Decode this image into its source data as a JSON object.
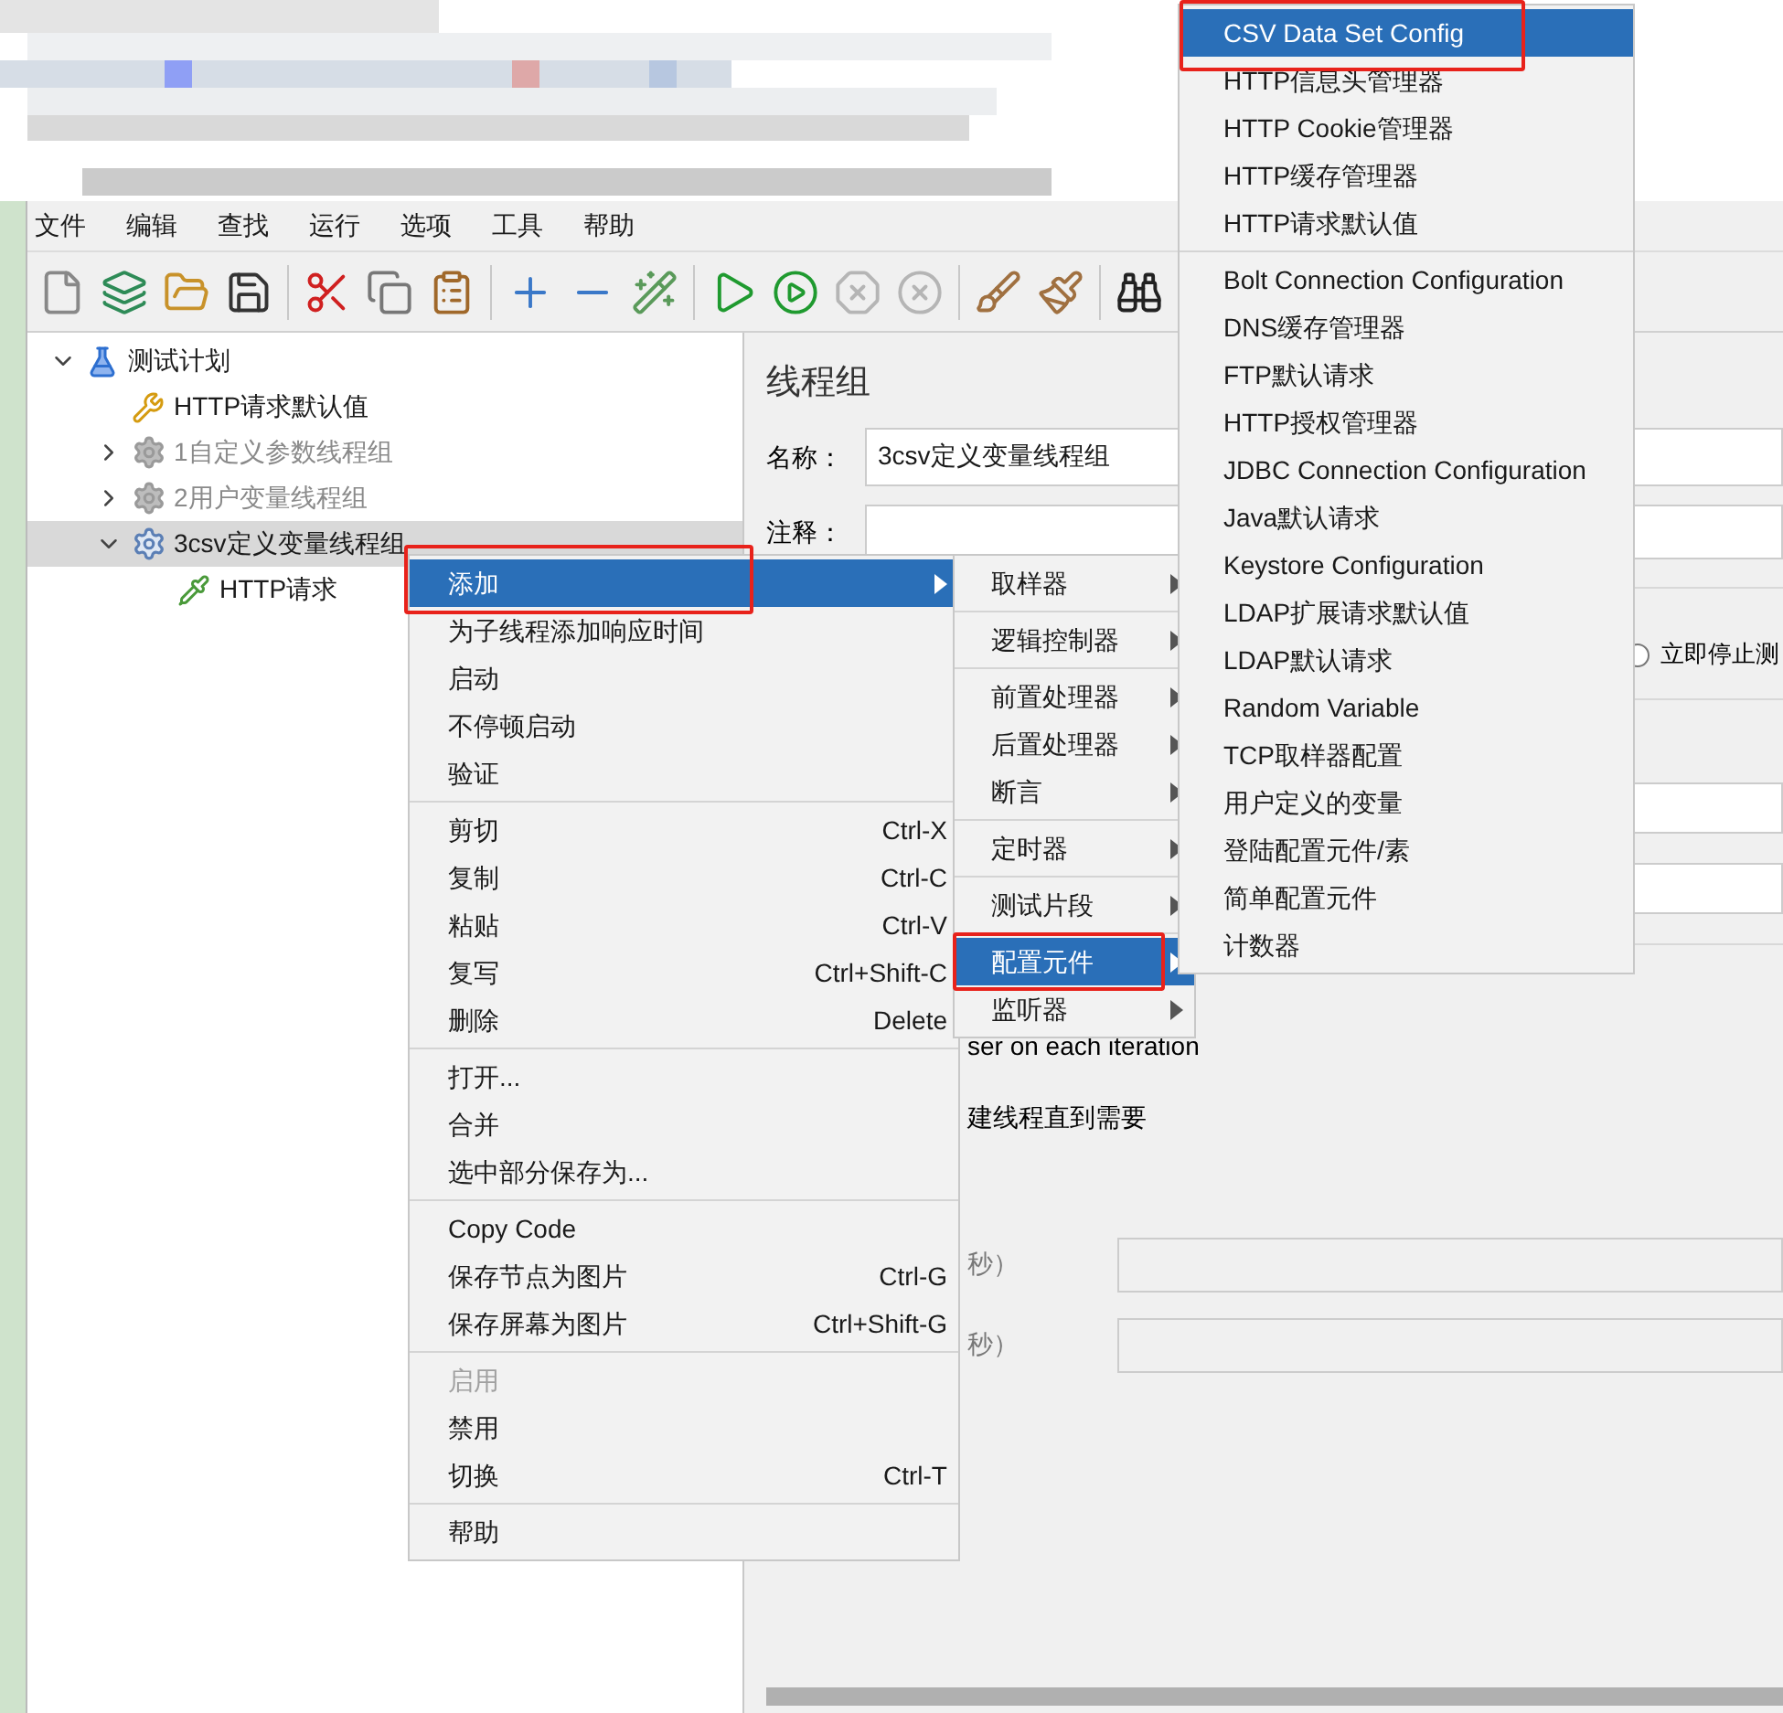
{
  "menu_bar": [
    {
      "label": "文件"
    },
    {
      "label": "编辑"
    },
    {
      "label": "查找"
    },
    {
      "label": "运行"
    },
    {
      "label": "选项"
    },
    {
      "label": "工具"
    },
    {
      "label": "帮助"
    }
  ],
  "tree": [
    {
      "label": "测试计划",
      "kind": "plan",
      "expanded": true,
      "selected": false,
      "disabled": false,
      "children": [
        {
          "label": "HTTP请求默认值",
          "kind": "config",
          "selected": false,
          "disabled": false
        },
        {
          "label": "1自定义参数线程组",
          "kind": "thread_group",
          "expanded": false,
          "selected": false,
          "disabled": true
        },
        {
          "label": "2用户变量线程组",
          "kind": "thread_group",
          "expanded": false,
          "selected": false,
          "disabled": true
        },
        {
          "label": "3csv定义变量线程组",
          "kind": "thread_group",
          "expanded": true,
          "selected": true,
          "disabled": false,
          "children": [
            {
              "label": "HTTP请求",
              "kind": "sampler",
              "selected": false,
              "disabled": false
            }
          ]
        }
      ]
    }
  ],
  "panel": {
    "title": "线程组",
    "name_label": "名称：",
    "name_value": "3csv定义变量线程组",
    "comment_label": "注释：",
    "option_text": "立即停止测",
    "option_selected": false,
    "iteration_text": "ser on each iteration",
    "delay_text": "建线程直到需要",
    "duration_labels": [
      "秒）",
      "秒）"
    ]
  },
  "context_menu": [
    [
      {
        "label": "添加",
        "submenu": true,
        "selected": true,
        "disabled": false
      },
      {
        "label": "为子线程添加响应时间",
        "submenu": false,
        "selected": false,
        "disabled": false
      },
      {
        "label": "启动",
        "submenu": false,
        "selected": false,
        "disabled": false
      },
      {
        "label": "不停顿启动",
        "submenu": false,
        "selected": false,
        "disabled": false
      },
      {
        "label": "验证",
        "submenu": false,
        "selected": false,
        "disabled": false
      }
    ],
    [
      {
        "label": "剪切",
        "shortcut": "Ctrl-X",
        "submenu": false,
        "selected": false,
        "disabled": false
      },
      {
        "label": "复制",
        "shortcut": "Ctrl-C",
        "submenu": false,
        "selected": false,
        "disabled": false
      },
      {
        "label": "粘贴",
        "shortcut": "Ctrl-V",
        "submenu": false,
        "selected": false,
        "disabled": false
      },
      {
        "label": "复写",
        "shortcut": "Ctrl+Shift-C",
        "submenu": false,
        "selected": false,
        "disabled": false
      },
      {
        "label": "删除",
        "shortcut": "Delete",
        "submenu": false,
        "selected": false,
        "disabled": false
      }
    ],
    [
      {
        "label": "打开...",
        "submenu": false,
        "selected": false,
        "disabled": false
      },
      {
        "label": "合并",
        "submenu": false,
        "selected": false,
        "disabled": false
      },
      {
        "label": "选中部分保存为...",
        "submenu": false,
        "selected": false,
        "disabled": false
      }
    ],
    [
      {
        "label": "Copy Code",
        "submenu": false,
        "selected": false,
        "disabled": false
      },
      {
        "label": "保存节点为图片",
        "shortcut": "Ctrl-G",
        "submenu": false,
        "selected": false,
        "disabled": false
      },
      {
        "label": "保存屏幕为图片",
        "shortcut": "Ctrl+Shift-G",
        "submenu": false,
        "selected": false,
        "disabled": false
      }
    ],
    [
      {
        "label": "启用",
        "submenu": false,
        "selected": false,
        "disabled": true
      },
      {
        "label": "禁用",
        "submenu": false,
        "selected": false,
        "disabled": false
      },
      {
        "label": "切换",
        "shortcut": "Ctrl-T",
        "submenu": false,
        "selected": false,
        "disabled": false
      }
    ],
    [
      {
        "label": "帮助",
        "submenu": false,
        "selected": false,
        "disabled": false
      }
    ]
  ],
  "add_submenu": [
    [
      {
        "label": "取样器",
        "selected": false
      }
    ],
    [
      {
        "label": "逻辑控制器",
        "selected": false
      }
    ],
    [
      {
        "label": "前置处理器",
        "selected": false
      },
      {
        "label": "后置处理器",
        "selected": false
      },
      {
        "label": "断言",
        "selected": false
      }
    ],
    [
      {
        "label": "定时器",
        "selected": false
      }
    ],
    [
      {
        "label": "测试片段",
        "selected": false
      }
    ],
    [
      {
        "label": "配置元件",
        "selected": true
      },
      {
        "label": "监听器",
        "selected": false
      }
    ]
  ],
  "config_submenu": [
    [
      {
        "label": "CSV Data Set Config",
        "selected": true
      },
      {
        "label": "HTTP信息头管理器",
        "selected": false
      },
      {
        "label": "HTTP Cookie管理器",
        "selected": false
      },
      {
        "label": "HTTP缓存管理器",
        "selected": false
      },
      {
        "label": "HTTP请求默认值",
        "selected": false
      }
    ],
    [
      {
        "label": "Bolt Connection Configuration",
        "selected": false
      },
      {
        "label": "DNS缓存管理器",
        "selected": false
      },
      {
        "label": "FTP默认请求",
        "selected": false
      },
      {
        "label": "HTTP授权管理器",
        "selected": false
      },
      {
        "label": "JDBC Connection Configuration",
        "selected": false
      },
      {
        "label": "Java默认请求",
        "selected": false
      },
      {
        "label": "Keystore Configuration",
        "selected": false
      },
      {
        "label": "LDAP扩展请求默认值",
        "selected": false
      },
      {
        "label": "LDAP默认请求",
        "selected": false
      },
      {
        "label": "Random Variable",
        "selected": false
      },
      {
        "label": "TCP取样器配置",
        "selected": false
      },
      {
        "label": "用户定义的变量",
        "selected": false
      },
      {
        "label": "登陆配置元件/素",
        "selected": false
      },
      {
        "label": "简单配置元件",
        "selected": false
      },
      {
        "label": "计数器",
        "selected": false
      }
    ]
  ]
}
